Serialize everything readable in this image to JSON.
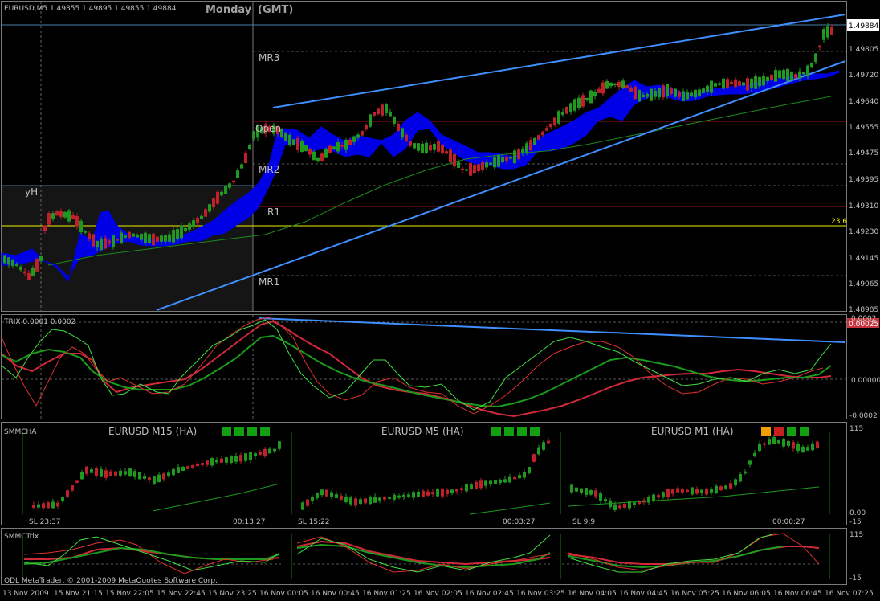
{
  "header": {
    "symbol_info": "EURUSD,M5  1.49855 1.49895 1.49855 1.49884",
    "day_label": "Monday",
    "tz_label": "(GMT)"
  },
  "colors": {
    "background": "#000000",
    "bull": "#1f9a1f",
    "bear": "#c0202a",
    "cloud": "#0000e6",
    "trendline": "#3f8fff",
    "ma": "#1c8a1c",
    "pivot_dash": "#5a5a5a",
    "red_line": "#a01818",
    "yellow_line": "#f0f000",
    "yh_line": "#4a7fa8",
    "grid_text": "#c0c0c0",
    "tag_red": "#c8323c",
    "sq_green": "#12a012",
    "sq_orange": "#f0a000",
    "sq_red": "#c82020"
  },
  "price_axis": {
    "labels": [
      "1.49884",
      "1.49805",
      "1.49720",
      "1.49640",
      "1.49555",
      "1.49475",
      "1.49395",
      "1.49310",
      "1.49230",
      "1.49145",
      "1.49065",
      "1.48985"
    ],
    "current_price": "1.49884"
  },
  "pivots": {
    "mr3": "MR3",
    "open": "Open",
    "mr2": "MR2",
    "r1": "R1",
    "mr1": "MR1",
    "yh": "yH",
    "fib": "23.6"
  },
  "trix": {
    "label": "TRIX 0.0001 0.0002",
    "axis_labels": [
      "0.0002",
      "0.00000",
      "-0.0002"
    ],
    "tag_value": "0.00025"
  },
  "smmcha": {
    "label": "SMMCHA",
    "axis_top": "115",
    "axis_bottom": "0.00",
    "axis_bottom2": "-15",
    "panels": [
      {
        "title": "EURUSD M15 (HA)",
        "sl": "SL 23:37",
        "timer": "00:13:27",
        "squares": [
          "green",
          "green",
          "green",
          "green"
        ]
      },
      {
        "title": "EURUSD M5 (HA)",
        "sl": "SL 15:22",
        "timer": "00:03:27",
        "squares": [
          "green",
          "green",
          "green",
          "green"
        ]
      },
      {
        "title": "EURUSD M1 (HA)",
        "sl": "SL 9:9",
        "timer": "00:00:27",
        "squares": [
          "orange",
          "red",
          "green",
          "green"
        ]
      }
    ]
  },
  "smmctrix": {
    "label": "SMMCTrix",
    "axis_top": "115",
    "axis_bottom": "-15"
  },
  "copyright": "ODL MetaTrader, © 2001-2009 MetaQuotes Software Corp.",
  "time_axis": [
    "13 Nov 2009",
    "15 Nov 21:15",
    "15 Nov 22:05",
    "15 Nov 22:45",
    "15 Nov 23:25",
    "16 Nov 00:05",
    "16 Nov 00:45",
    "16 Nov 01:25",
    "16 Nov 02:05",
    "16 Nov 02:45",
    "16 Nov 03:25",
    "16 Nov 04:05",
    "16 Nov 04:45",
    "16 Nov 05:25",
    "16 Nov 06:05",
    "16 Nov 06:45",
    "16 Nov 07:25"
  ]
}
